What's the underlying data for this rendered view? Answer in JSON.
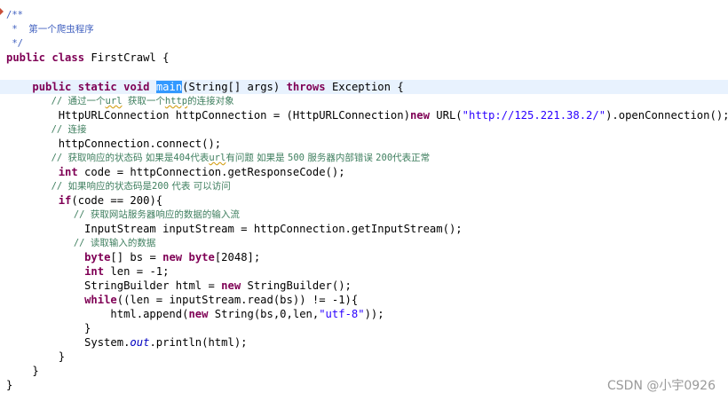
{
  "editor": {
    "selected_word": "main",
    "lines": [
      [
        {
          "t": "/**",
          "c": "doc"
        }
      ],
      [
        {
          "t": " *  ",
          "c": "doc"
        },
        {
          "t": "第一个爬虫程序",
          "c": "doc cjk"
        }
      ],
      [
        {
          "t": " */",
          "c": "doc"
        }
      ],
      [
        {
          "t": "public",
          "c": "kw"
        },
        {
          "t": " "
        },
        {
          "t": "class",
          "c": "kw"
        },
        {
          "t": " FirstCrawl {"
        }
      ],
      [],
      [
        {
          "t": "    "
        },
        {
          "t": "public",
          "c": "kw"
        },
        {
          "t": " "
        },
        {
          "t": "static",
          "c": "kw"
        },
        {
          "t": " "
        },
        {
          "t": "void",
          "c": "kw"
        },
        {
          "t": " "
        },
        {
          "t": "main",
          "c": "sel"
        },
        {
          "t": "(String[] args) "
        },
        {
          "t": "throws",
          "c": "kw"
        },
        {
          "t": " Exception {"
        }
      ],
      [
        {
          "t": "        "
        },
        {
          "t": "// ",
          "c": "cmt"
        },
        {
          "t": "通过一个",
          "c": "cmt cjk"
        },
        {
          "t": "url",
          "c": "cmt warn"
        },
        {
          "t": " ",
          "c": "cmt"
        },
        {
          "t": "获取一个",
          "c": "cmt cjk"
        },
        {
          "t": "http",
          "c": "cmt warn"
        },
        {
          "t": "的连接对象",
          "c": "cmt cjk"
        }
      ],
      [
        {
          "t": "        HttpURLConnection httpConnection = (HttpURLConnection)"
        },
        {
          "t": "new",
          "c": "kw"
        },
        {
          "t": " URL("
        },
        {
          "t": "\"http://125.221.38.2/\"",
          "c": "str"
        },
        {
          "t": ").openConnection();"
        }
      ],
      [
        {
          "t": "        "
        },
        {
          "t": "// ",
          "c": "cmt"
        },
        {
          "t": "连接",
          "c": "cmt cjk"
        }
      ],
      [
        {
          "t": "        httpConnection.connect();"
        }
      ],
      [
        {
          "t": "        "
        },
        {
          "t": "// ",
          "c": "cmt"
        },
        {
          "t": "获取响应的状态码 如果是",
          "c": "cmt cjk"
        },
        {
          "t": "404",
          "c": "cmt"
        },
        {
          "t": "代表",
          "c": "cmt cjk"
        },
        {
          "t": "url",
          "c": "cmt warn"
        },
        {
          "t": "有问题 如果是 ",
          "c": "cmt cjk"
        },
        {
          "t": "500",
          "c": "cmt"
        },
        {
          "t": " 服务器内部错误 ",
          "c": "cmt cjk"
        },
        {
          "t": "200",
          "c": "cmt"
        },
        {
          "t": "代表正常",
          "c": "cmt cjk"
        }
      ],
      [
        {
          "t": "        "
        },
        {
          "t": "int",
          "c": "kw"
        },
        {
          "t": " code = httpConnection.getResponseCode();"
        }
      ],
      [
        {
          "t": "        "
        },
        {
          "t": "// ",
          "c": "cmt"
        },
        {
          "t": "如果响应的状态码是",
          "c": "cmt cjk"
        },
        {
          "t": "200",
          "c": "cmt"
        },
        {
          "t": " 代表 可以访问",
          "c": "cmt cjk"
        }
      ],
      [
        {
          "t": "        "
        },
        {
          "t": "if",
          "c": "kw"
        },
        {
          "t": "(code == 200){"
        }
      ],
      [
        {
          "t": "            "
        },
        {
          "t": "// ",
          "c": "cmt"
        },
        {
          "t": "获取网站服务器响应的数据的输入流",
          "c": "cmt cjk"
        }
      ],
      [
        {
          "t": "            InputStream inputStream = httpConnection.getInputStream();"
        }
      ],
      [
        {
          "t": "            "
        },
        {
          "t": "// ",
          "c": "cmt"
        },
        {
          "t": "读取输入的数据",
          "c": "cmt cjk"
        }
      ],
      [
        {
          "t": "            "
        },
        {
          "t": "byte",
          "c": "kw"
        },
        {
          "t": "[] bs = "
        },
        {
          "t": "new",
          "c": "kw"
        },
        {
          "t": " "
        },
        {
          "t": "byte",
          "c": "kw"
        },
        {
          "t": "[2048];"
        }
      ],
      [
        {
          "t": "            "
        },
        {
          "t": "int",
          "c": "kw"
        },
        {
          "t": " len = -1;"
        }
      ],
      [
        {
          "t": "            StringBuilder html = "
        },
        {
          "t": "new",
          "c": "kw"
        },
        {
          "t": " StringBuilder();"
        }
      ],
      [
        {
          "t": "            "
        },
        {
          "t": "while",
          "c": "kw"
        },
        {
          "t": "((len = inputStream.read(bs)) != -1){"
        }
      ],
      [
        {
          "t": "                html.append("
        },
        {
          "t": "new",
          "c": "kw"
        },
        {
          "t": " String(bs,0,len,"
        },
        {
          "t": "\"utf-8\"",
          "c": "str"
        },
        {
          "t": "));"
        }
      ],
      [
        {
          "t": "            }"
        }
      ],
      [
        {
          "t": "            System."
        },
        {
          "t": "out",
          "c": "fld"
        },
        {
          "t": ".println(html);"
        }
      ],
      [
        {
          "t": "        }"
        }
      ],
      [
        {
          "t": "    }"
        }
      ],
      [
        {
          "t": "}"
        }
      ]
    ]
  },
  "watermark": "CSDN @小宇0926",
  "colors": {
    "keyword": "#7f0055",
    "javadoc": "#3f5fbf",
    "comment": "#3f7f5f",
    "string": "#2a00ff",
    "field": "#0000c0",
    "selection": "#3399ff",
    "current_line": "#e8f2fe",
    "fold_marker": "#c84f3a"
  }
}
